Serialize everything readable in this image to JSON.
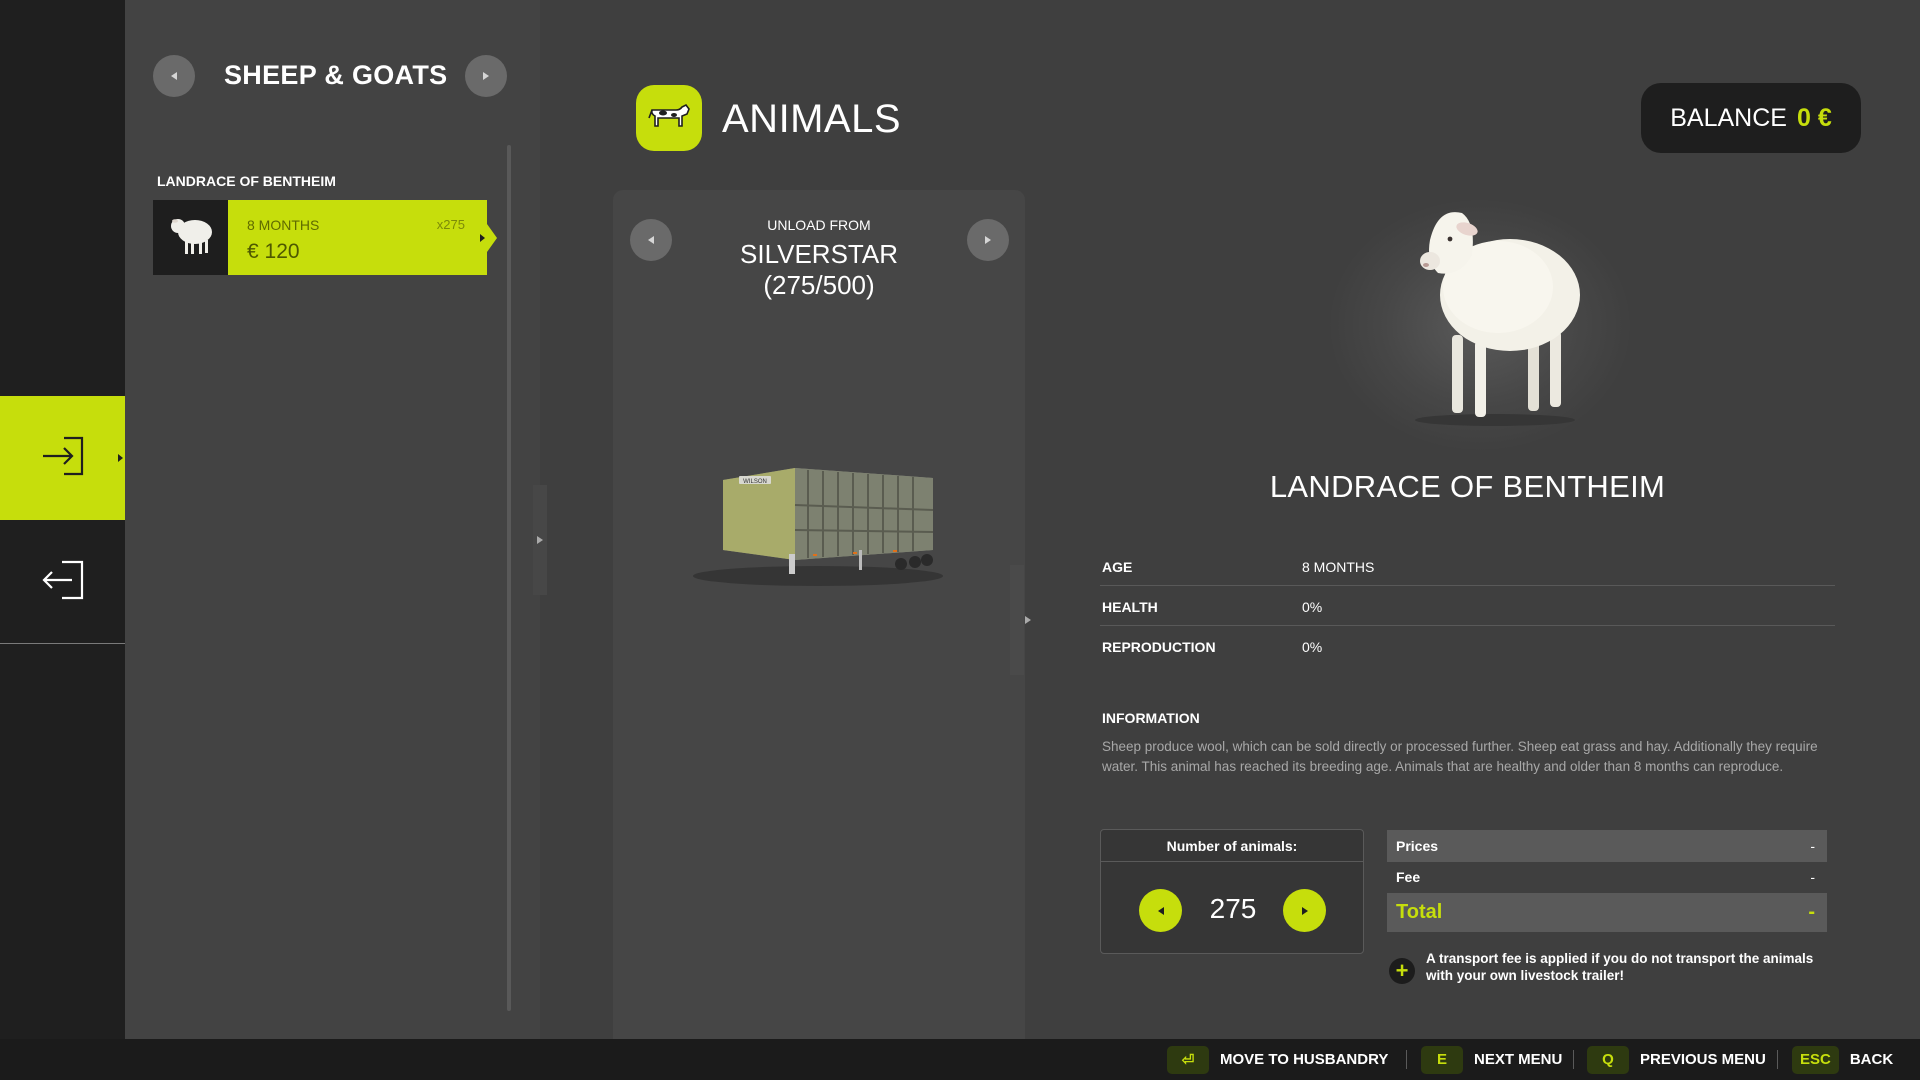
{
  "category": {
    "title": "SHEEP & GOATS"
  },
  "breed_list": {
    "heading": "LANDRACE OF BENTHEIM",
    "items": [
      {
        "age": "8 MONTHS",
        "count": "x275",
        "price": "€ 120"
      }
    ]
  },
  "header": {
    "title": "ANIMALS",
    "balance_label": "BALANCE",
    "balance_value": "0 €"
  },
  "trailer": {
    "unload_label": "UNLOAD FROM",
    "name": "SILVERSTAR",
    "capacity": "(275/500)",
    "brand_plate": "WILSON"
  },
  "details": {
    "breed_name": "LANDRACE OF BENTHEIM",
    "stats": [
      {
        "label": "AGE",
        "value": "8 MONTHS"
      },
      {
        "label": "HEALTH",
        "value": "0%"
      },
      {
        "label": "REPRODUCTION",
        "value": "0%"
      }
    ],
    "information_heading": "INFORMATION",
    "information_text": "Sheep produce wool, which can be sold directly or processed further. Sheep eat grass and hay. Additionally they require water. This animal has reached its breeding age. Animals that are healthy and older than 8 months can reproduce."
  },
  "quantity": {
    "label": "Number of animals:",
    "value": "275"
  },
  "prices": {
    "prices_label": "Prices",
    "prices_value": "-",
    "fee_label": "Fee",
    "fee_value": "-",
    "total_label": "Total",
    "total_value": "-"
  },
  "note": {
    "icon": "plus-icon",
    "text": "A transport fee is applied if you do not transport the animals with your own livestock trailer!"
  },
  "footer": {
    "hints": [
      {
        "key": "⏎",
        "label": "MOVE TO HUSBANDRY"
      },
      {
        "key": "E",
        "label": "NEXT MENU"
      },
      {
        "key": "Q",
        "label": "PREVIOUS MENU"
      },
      {
        "key": "ESC",
        "label": "BACK"
      }
    ]
  },
  "colors": {
    "accent": "#c6de0c",
    "background": "#3f3f3f",
    "panel": "#434343",
    "rail": "#1f1f1f"
  },
  "icons": [
    "enter-icon",
    "exit-icon",
    "sheep-icon",
    "cow-icon",
    "trailer-icon",
    "plus-icon",
    "return-key-icon"
  ]
}
